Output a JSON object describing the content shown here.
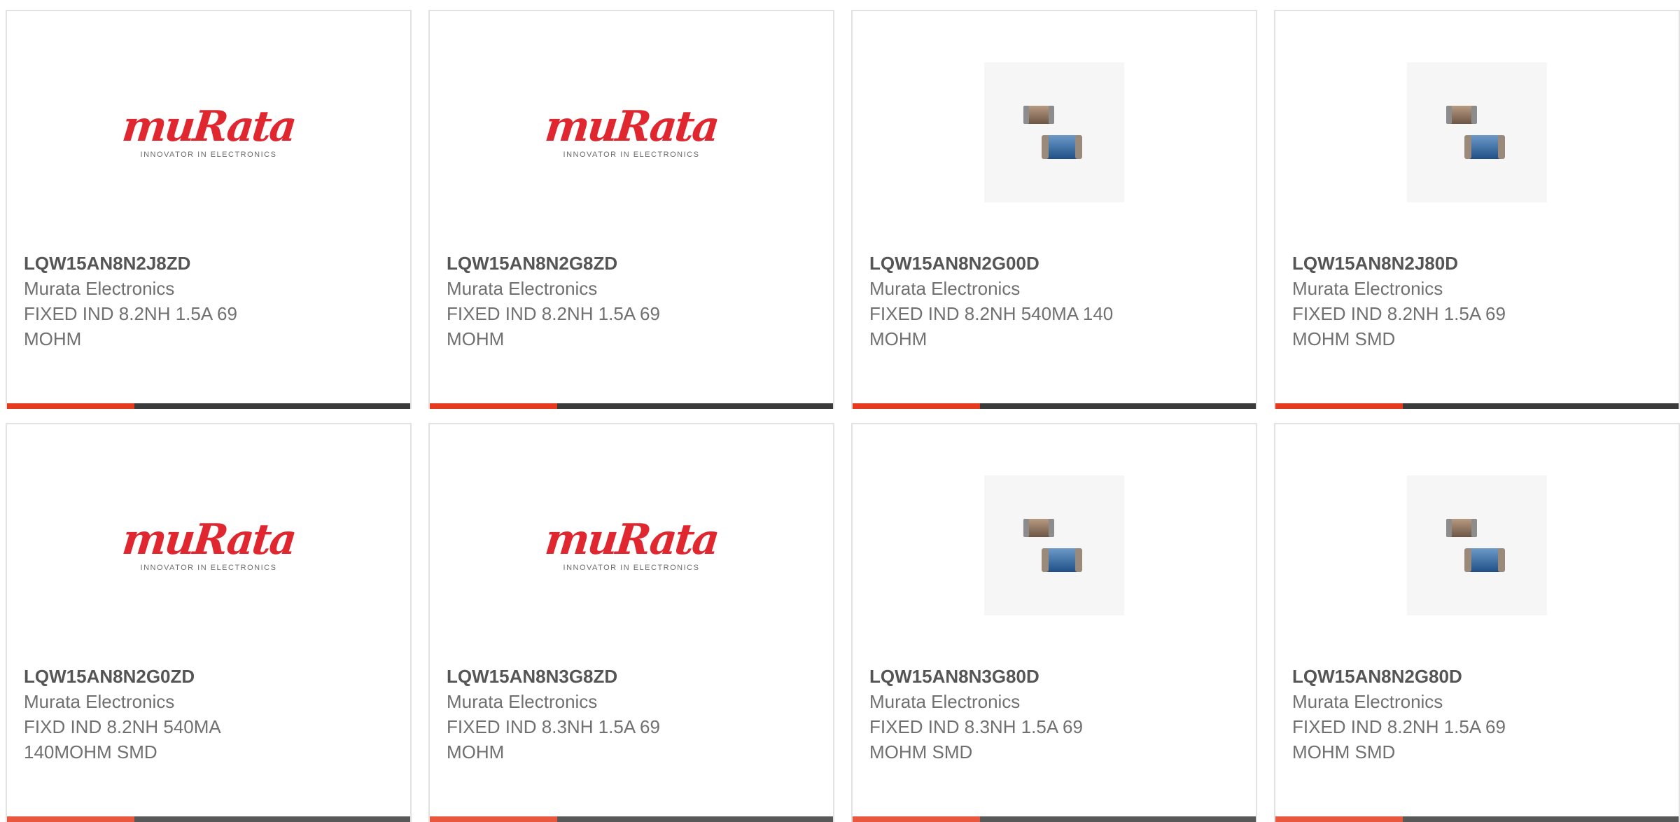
{
  "brand_logo": {
    "wordmark": "muRata",
    "tagline": "INNOVATOR IN ELECTRONICS"
  },
  "colors": {
    "accent": "#e63a1e",
    "bar_dark": "#3b3b3b",
    "logo_red": "#e0262e"
  },
  "products": [
    {
      "part_number": "LQW15AN8N2J8ZD",
      "manufacturer": "Murata Electronics",
      "description": "FIXED IND 8.2NH 1.5A 69 MOHM",
      "image_type": "murata-logo"
    },
    {
      "part_number": "LQW15AN8N2G8ZD",
      "manufacturer": "Murata Electronics",
      "description": "FIXED IND 8.2NH 1.5A 69 MOHM",
      "image_type": "murata-logo"
    },
    {
      "part_number": "LQW15AN8N2G00D",
      "manufacturer": "Murata Electronics",
      "description": "FIXED IND 8.2NH 540MA 140 MOHM",
      "image_type": "inductor-photo"
    },
    {
      "part_number": "LQW15AN8N2J80D",
      "manufacturer": "Murata Electronics",
      "description": "FIXED IND 8.2NH 1.5A 69 MOHM SMD",
      "image_type": "inductor-photo"
    },
    {
      "part_number": "LQW15AN8N2G0ZD",
      "manufacturer": "Murata Electronics",
      "description": "FIXD IND 8.2NH 540MA 140MOHM SMD",
      "image_type": "murata-logo"
    },
    {
      "part_number": "LQW15AN8N3G8ZD",
      "manufacturer": "Murata Electronics",
      "description": "FIXED IND 8.3NH 1.5A 69 MOHM",
      "image_type": "murata-logo"
    },
    {
      "part_number": "LQW15AN8N3G80D",
      "manufacturer": "Murata Electronics",
      "description": "FIXED IND 8.3NH 1.5A 69 MOHM SMD",
      "image_type": "inductor-photo"
    },
    {
      "part_number": "LQW15AN8N2G80D",
      "manufacturer": "Murata Electronics",
      "description": "FIXED IND 8.2NH 1.5A 69 MOHM SMD",
      "image_type": "inductor-photo"
    }
  ]
}
